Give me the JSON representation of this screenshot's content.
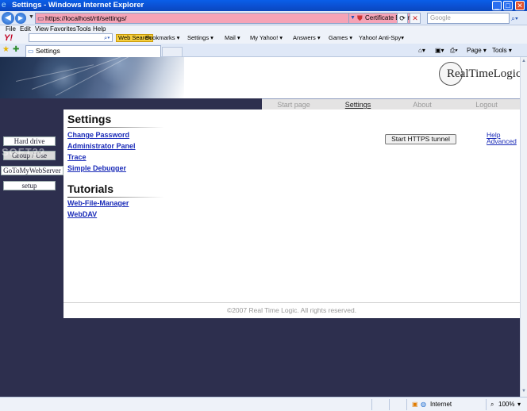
{
  "window": {
    "title": "Settings - Windows Internet Explorer",
    "controls": {
      "minimize": "_",
      "maximize": "□",
      "close": "✕"
    }
  },
  "addressbar": {
    "back_icon": "back-arrow-icon",
    "forward_icon": "forward-arrow-icon",
    "url": "https://localhost/rtl/settings/",
    "cert_error": "Certificate Error",
    "search_placeholder": "Google"
  },
  "menu": [
    "File",
    "Edit",
    "View",
    "Favorites",
    "Tools",
    "Help"
  ],
  "yahoo_toolbar": {
    "logo": "Y!",
    "web_search": "Web Search",
    "items": [
      "Bookmarks ▾",
      "Settings ▾",
      "Mail ▾",
      "My Yahoo! ▾",
      "Answers ▾",
      "Games ▾",
      "Yahoo! Anti-Spy▾"
    ]
  },
  "tabs": {
    "active_label": "Settings",
    "tools": [
      "Page ▾",
      "Tools ▾"
    ]
  },
  "site": {
    "logo_text": "RealTimeLogic",
    "topnav": [
      "Start page",
      "Settings",
      "About",
      "Logout"
    ],
    "active_nav": "Settings",
    "sidebar": [
      "Hard drive",
      "Group / Use",
      "GoToMyWebServer",
      "setup"
    ],
    "watermark": "SOFT32",
    "settings_heading": "Settings",
    "settings_links": [
      "Change Password",
      "Administrator Panel",
      "Trace",
      "Simple Debugger"
    ],
    "tunnel_button": "Start HTTPS tunnel",
    "help_links": [
      "Help",
      "Advanced"
    ],
    "tutorials_heading": "Tutorials",
    "tutorial_links": [
      "Web-File-Manager",
      "WebDAV"
    ],
    "footer": "©2007 Real Time Logic. All rights reserved."
  },
  "status": {
    "zone": "Internet",
    "zoom": "100%"
  },
  "colors": {
    "site_dark": "#2d2f4e",
    "link": "#1a2bb8",
    "cert_error_bg": "#f5a3b6",
    "titlebar": "#0b4fd0"
  }
}
